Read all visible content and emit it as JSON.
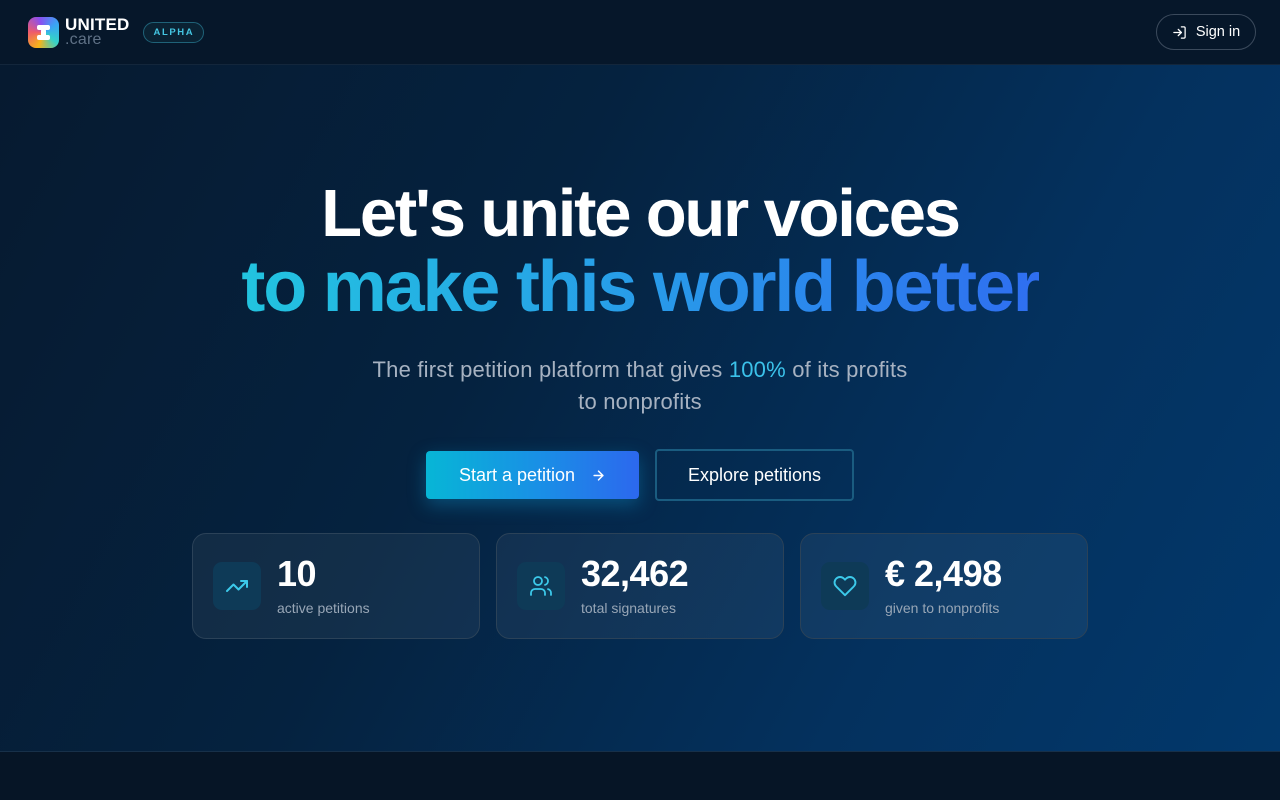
{
  "header": {
    "logo_line1": "UNITED",
    "logo_line2": ".care",
    "badge": "ALPHA",
    "signin_label": "Sign in",
    "signin_icon": "log-in-icon"
  },
  "hero": {
    "headline_line1": "Let's unite our voices",
    "headline_line2": "to make this world better",
    "subtitle_before": "The first petition platform that gives ",
    "subtitle_highlight": "100%",
    "subtitle_after": " of its profits",
    "subtitle_line2": "to nonprofits",
    "primary_button": "Start a petition",
    "primary_button_icon": "arrow-right-icon",
    "secondary_button": "Explore petitions"
  },
  "stats": [
    {
      "value": "10",
      "label": "active petitions",
      "icon": "trending-up-icon"
    },
    {
      "value": "32,462",
      "label": "total signatures",
      "icon": "users-icon"
    },
    {
      "value": "€ 2,498",
      "label": "given to nonprofits",
      "icon": "heart-icon"
    }
  ],
  "colors": {
    "accent_cyan": "#22c4df",
    "accent_blue": "#2f6ef0",
    "background": "#061526"
  }
}
